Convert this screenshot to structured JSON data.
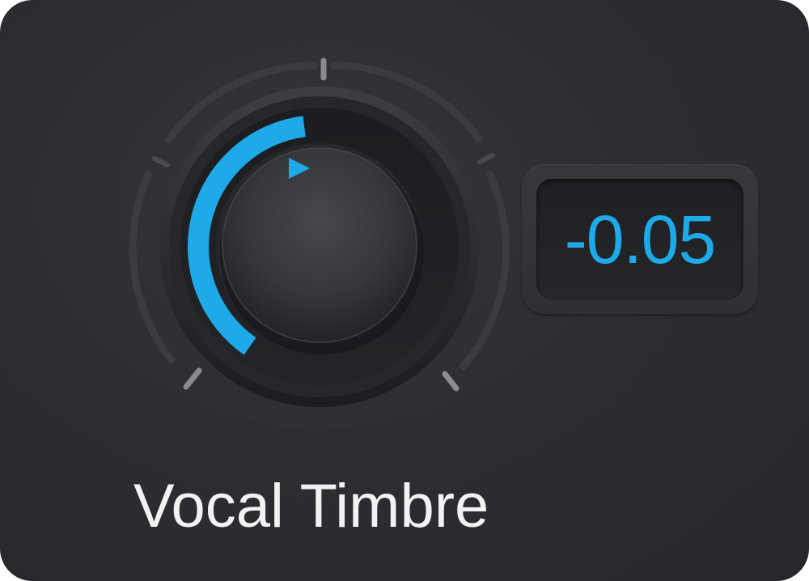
{
  "parameter": {
    "label": "Vocal Timbre",
    "value_text": "-0.05",
    "value": -0.05,
    "range": [
      -1,
      1
    ]
  },
  "colors": {
    "accent": "#1ea9e8",
    "panel_background": "#2d2e32",
    "label_text": "#f2f2f2"
  },
  "icons": {
    "pointer": "triangle-right-icon"
  }
}
